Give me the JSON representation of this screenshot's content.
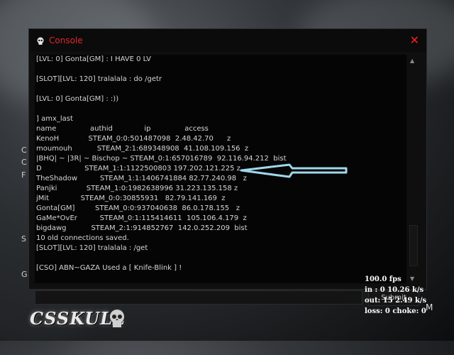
{
  "console": {
    "title": "Console",
    "close_label": "✕",
    "log_lines": [
      "[LVL: 0] Gonta[GM] : I HAVE 0 LV",
      "",
      "[SLOT][LVL: 120] tralalala : do /getr",
      "",
      "[LVL: 0] Gonta[GM] : :))",
      "",
      "] amx_last",
      "name               authid              ip               access",
      "KenoH             STEAM_0:0:501487098  2.48.42.70      z",
      "moumouh           STEAM_2:1:689348908  41.108.109.156  z",
      "|BHQ| ~ |3R| ~ Bischop ~ STEAM_0:1:657016789  92.116.94.212  bist",
      "D                   STEAM_1:1:1122500803 197.202.121.225 z",
      "TheShadow          STEAM_1:1:1406741884 82.77.240.98   z",
      "Panjki             STEAM_1:0:1982638996 31.223.135.158 z",
      "jMit              STEAM_0:0:30855931   82.79.141.169  z",
      "Gonta[GM]         STEAM_0:0:937040638  86.0.178.155   z",
      "GaMe*OvEr          STEAM_0:1:115414611  105.106.4.179  z",
      "bigdawg           STEAM_2:1:914852767  142.0.252.209  bist",
      "10 old connections saved.",
      "[SLOT][LVL: 120] tralalala : /get",
      "",
      "[CSO] ABN~GAZA Used a [ Knife-Blink ] !"
    ],
    "input_value": "",
    "submit_label": "Submit"
  },
  "net_stats": {
    "fps": "100.0 fps",
    "in": "in :  0 10.26 k/s",
    "out": "out:  15 2.49 k/s",
    "loss": "loss: 0 choke:  0"
  },
  "background": {
    "menu_letters": [
      "C",
      "C",
      "F",
      "S",
      "G"
    ],
    "corner_letter": "M"
  },
  "logo": {
    "text": "CSSKULL"
  },
  "annotation": {
    "color": "#9fd8ea"
  }
}
